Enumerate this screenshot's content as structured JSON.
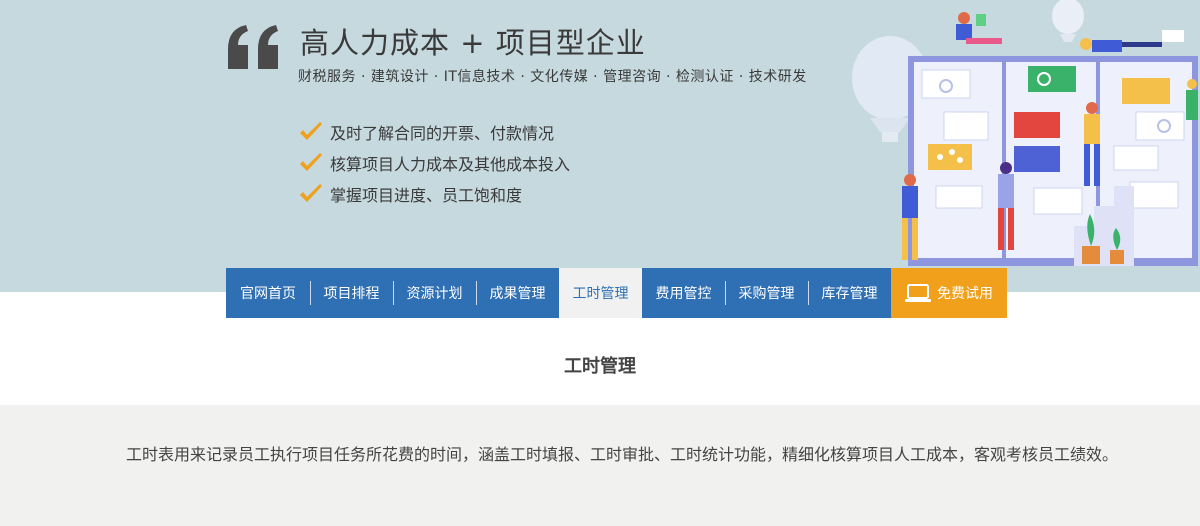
{
  "hero": {
    "quote": "“",
    "title": "高人力成本 + 项目型企业",
    "subtitle": "财税服务 · 建筑设计 · IT信息技术 · 文化传媒 · 管理咨询 · 检测认证 · 技术研发",
    "bullets": [
      "及时了解合同的开票、付款情况",
      "核算项目人力成本及其他成本投入",
      "掌握项目进度、员工饱和度"
    ],
    "check_color": "#f0a01b"
  },
  "nav": {
    "items": [
      "官网首页",
      "项目排程",
      "资源计划",
      "成果管理",
      "工时管理",
      "费用管控",
      "采购管理",
      "库存管理"
    ],
    "active": "工时管理",
    "trial_label": "免费试用",
    "trial_icon": "laptop-icon"
  },
  "section": {
    "title": "工时管理",
    "description": "工时表用来记录员工执行项目任务所花费的时间，涵盖工时填报、工时审批、工时统计功能，精细化核算项目人工成本，客观考核员工绩效。"
  },
  "colors": {
    "hero_bg": "#c6d9df",
    "nav_blue": "#2f6fb3",
    "trial_orange": "#f0a01b",
    "desc_bg": "#f1f1ef"
  }
}
